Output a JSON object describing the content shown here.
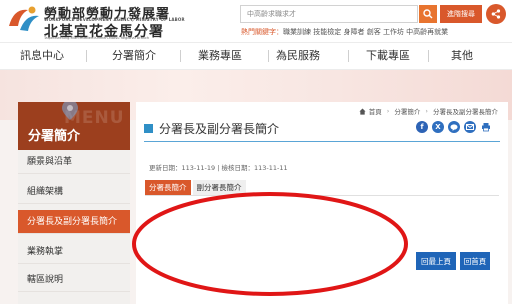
{
  "header": {
    "org_name_zh": "勞動部勞動力發展署",
    "org_name_en": "WORKFORCE DEVELOPMENT AGENCY, MINISTRY OF LABOR",
    "branch_name_zh": "北基宜花金馬分署",
    "branch_name_en": "Taipei-Keelung-Yilan-Hualien-Kinmen-Matsu Regional Branch",
    "search_placeholder": "中高齡求職求才",
    "search_icon": "search-icon",
    "advanced_search_label": "進階搜尋",
    "share_icon": "share-icon",
    "hot_keywords_label": "熱門關鍵字：",
    "hot_keywords": [
      "職業訓練",
      "技能檢定",
      "身障者",
      "創客",
      "工作坊",
      "中高齡再就業"
    ]
  },
  "nav": {
    "items": [
      {
        "label": "訊息中心"
      },
      {
        "label": "分署簡介"
      },
      {
        "label": "業務專區"
      },
      {
        "label": "為民服務"
      },
      {
        "label": "下載專區"
      },
      {
        "label": "其他"
      }
    ]
  },
  "sidebar": {
    "watermark": "MENU",
    "title": "分署簡介",
    "items": [
      {
        "label": "願景與沿革",
        "active": false
      },
      {
        "label": "組織架構",
        "active": false
      },
      {
        "label": "分署長及副分署長簡介",
        "active": true
      },
      {
        "label": "業務執掌",
        "active": false
      },
      {
        "label": "轄區說明",
        "active": false
      }
    ]
  },
  "main": {
    "breadcrumb": {
      "home_icon": "home-icon",
      "home": "首頁",
      "items": [
        "分署簡介",
        "分署長及副分署長簡介"
      ]
    },
    "page_title": "分署長及副分署長簡介",
    "share_icons": [
      "facebook-icon",
      "x-icon",
      "line-icon",
      "email-icon",
      "print-icon"
    ],
    "updated": "更新日期：113-11-19",
    "reviewed": "檢核日期：113-11-11",
    "tabs": [
      {
        "label": "分署長簡介",
        "active": true
      },
      {
        "label": "副分署長簡介",
        "active": false
      }
    ],
    "back_button": "回最上頁",
    "home_button": "回首頁"
  },
  "colors": {
    "accent_orange": "#d9582b",
    "sidebar_title_bg": "#9c3f1e",
    "title_blue": "#2f8fc6",
    "button_blue": "#1f65b8",
    "annotation_red": "#e01616"
  }
}
